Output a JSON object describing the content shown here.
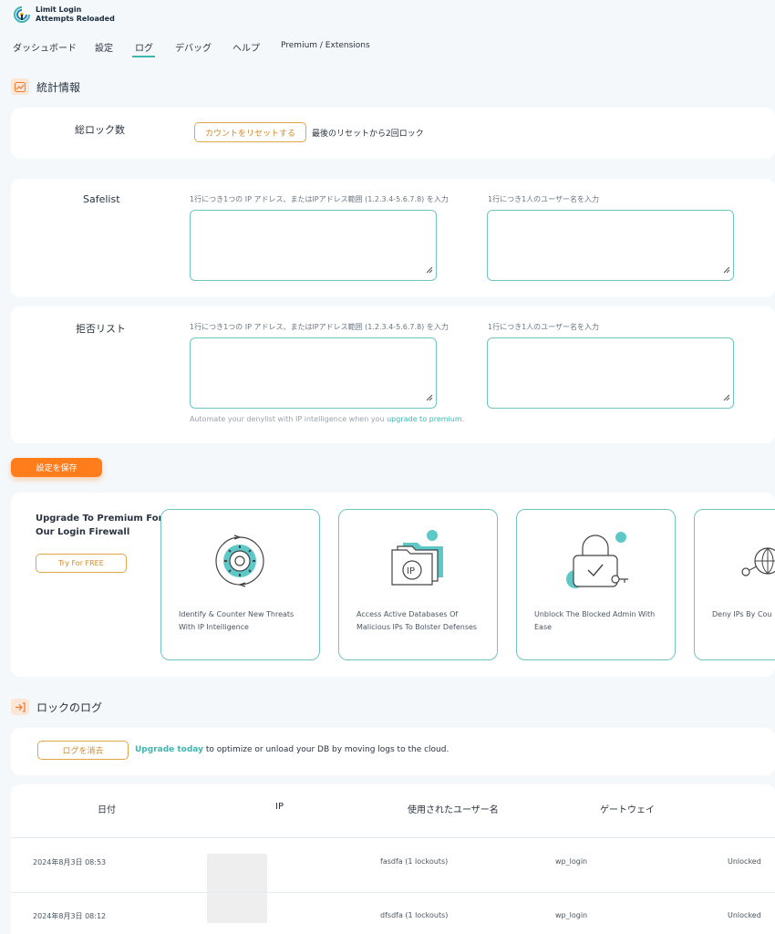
{
  "app": {
    "logo_line1": "Limit Login",
    "logo_line2": "Attempts Reloaded"
  },
  "nav": {
    "tabs": [
      {
        "label": "ダッシュボード"
      },
      {
        "label": "設定"
      },
      {
        "label": "ログ"
      },
      {
        "label": "デバッグ"
      },
      {
        "label": "ヘルプ"
      },
      {
        "label": "Premium / Extensions"
      }
    ],
    "active_tab": "ログ"
  },
  "stats": {
    "title": "統計情報",
    "total_lockouts_label": "総ロック数",
    "reset_button": "カウントをリセットする",
    "reset_info": "最後のリセットから2回ロック"
  },
  "safelist": {
    "label": "Safelist",
    "ip_hint": "1行につき1つの IP アドレス、またはIPアドレス範囲 (1.2.3.4-5.6.7.8) を入力",
    "user_hint": "1行につき1人のユーザー名を入力",
    "ip_value": "",
    "user_value": ""
  },
  "denylist": {
    "label": "拒否リスト",
    "ip_hint": "1行につき1つの IP アドレス、またはIPアドレス範囲 (1.2.3.4-5.6.7.8) を入力",
    "user_hint": "1行につき1人のユーザー名を入力",
    "ip_value": "",
    "user_value": "",
    "automate_text": "Automate your denylist with IP intelligence when you ",
    "automate_link": "upgrade to premium",
    "automate_end": "."
  },
  "save_button": "設定を保存",
  "upgrade": {
    "title_line1": "Upgrade To Premium For",
    "title_line2": "Our Login Firewall",
    "try_button": "Try For FREE",
    "features": [
      {
        "icon": "gear-cycle-icon",
        "line1": "Identify & Counter New Threats",
        "line2": "With IP Intelligence"
      },
      {
        "icon": "ip-folder-icon",
        "line1": "Access Active Databases Of",
        "line2": "Malicious IPs To Bolster Defenses"
      },
      {
        "icon": "padlock-icon",
        "line1": "Unblock The Blocked Admin With",
        "line2": "Ease"
      },
      {
        "icon": "globe-network-icon",
        "line1": "Deny IPs By Cou",
        "line2": ""
      }
    ]
  },
  "lockout_log": {
    "title": "ロックのログ",
    "clear_button": "ログを消去",
    "upgrade_link": "Upgrade today",
    "upgrade_text": " to optimize or unload your DB by moving logs to the cloud.",
    "columns": [
      "日付",
      "IP",
      "使用されたユーザー名",
      "ゲートウェイ"
    ],
    "rows": [
      {
        "date": "2024年8月3日 08:53",
        "ip": "",
        "username": "fasdfa (1 lockouts)",
        "gateway": "wp_login",
        "status": "Unlocked"
      },
      {
        "date": "2024年8月3日 08:12",
        "ip": "",
        "username": "dfsdfa (1 lockouts)",
        "gateway": "wp_login",
        "status": "Unlocked"
      }
    ]
  },
  "colors": {
    "accent_teal": "#3db6b0",
    "accent_orange": "#ff7d1a",
    "outline_orange": "#e0a44a",
    "background": "#f4f8fb"
  }
}
